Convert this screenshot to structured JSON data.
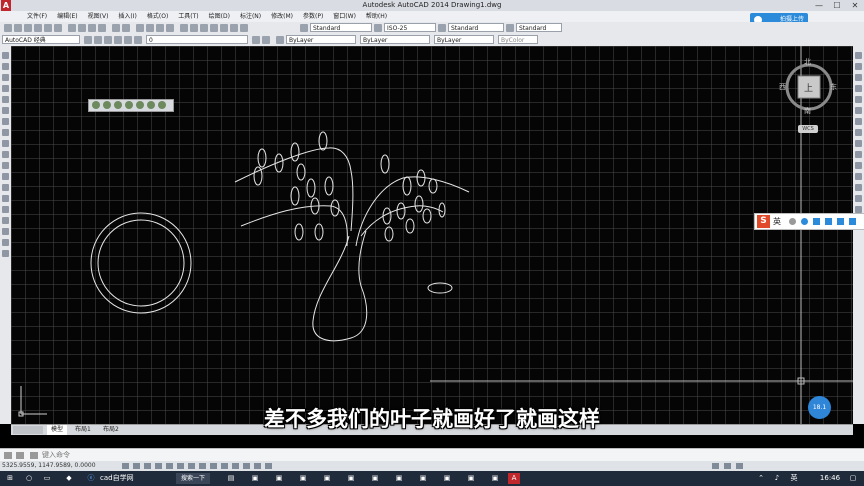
{
  "window": {
    "title": "Autodesk AutoCAD 2014    Drawing1.dwg",
    "logo": "A",
    "min": "—",
    "max": "☐",
    "close": "✕"
  },
  "menu": [
    "文件(F)",
    "编辑(E)",
    "视图(V)",
    "插入(I)",
    "格式(O)",
    "工具(T)",
    "绘图(D)",
    "标注(N)",
    "修改(M)",
    "参数(P)",
    "窗口(W)",
    "帮助(H)"
  ],
  "upload_button": "拍摄上传",
  "toolbar1": {
    "text_style": "Standard",
    "dim_style": "ISO-25",
    "table_style": "Standard",
    "multileader_style": "Standard"
  },
  "toolbar2": {
    "workspace": "AutoCAD 经典",
    "layer": "0",
    "color": "ByLayer",
    "linetype": "ByLayer",
    "lineweight": "ByLayer",
    "plotstyle": "ByColor"
  },
  "viewcube": {
    "north": "北",
    "south": "南",
    "east": "东",
    "west": "西",
    "top": "上",
    "wcs": "WCS"
  },
  "tabs": [
    "模型",
    "布局1",
    "布局2"
  ],
  "command_prompt": "键入命令",
  "status_coords": "5325.9559, 1147.9589, 0.0000",
  "ime": {
    "badge": "S",
    "label": "英"
  },
  "taskbar": {
    "search": "搜索一下",
    "app_label": "cad自学网",
    "lang": "英",
    "time": "16:46"
  },
  "corner_button": "18.1",
  "subtitle": "差不多我们的叶子就画好了就画这样",
  "colors": {
    "accent": "#2b8ad9",
    "canvas": "#050505",
    "grid": "#464646",
    "ime": "#e04a2a"
  }
}
